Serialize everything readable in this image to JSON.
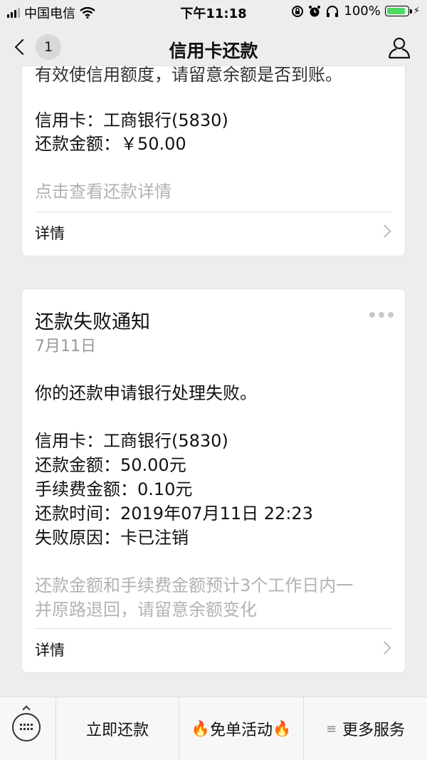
{
  "status_bar": {
    "carrier": "中国电信",
    "time": "下午11:18",
    "battery": "100%",
    "battery_level": 1.0
  },
  "nav": {
    "back_badge": "1",
    "title": "信用卡还款"
  },
  "card1": {
    "cut_text": "有效使信用额度，请留意余额是否到账。",
    "credit_card": "信用卡：工商银行(5830)",
    "amount": "还款金额：￥50.00",
    "hint": "点击查看还款详情",
    "details_label": "详情"
  },
  "card2": {
    "title": "还款失败通知",
    "date": "7月11日",
    "message": "你的还款申请银行处理失败。",
    "credit_card": "信用卡：工商银行(5830)",
    "amount": "还款金额：50.00元",
    "fee": "手续费金额：0.10元",
    "time": "还款时间：2019年07月11日  22:23",
    "reason": "失败原因：卡已注销",
    "note_line1": "还款金额和手续费金额预计3个工作日内一",
    "note_line2": "并原路退回，请留意余额变化",
    "details_label": "详情"
  },
  "bottom_bar": {
    "item1": "立即还款",
    "item2": "免单活动",
    "item3": "更多服务"
  },
  "colors": {
    "background": "#ededed",
    "battery_green": "#4cd964",
    "muted_text": "#b2b2b2",
    "flame": "#f25a0f"
  }
}
